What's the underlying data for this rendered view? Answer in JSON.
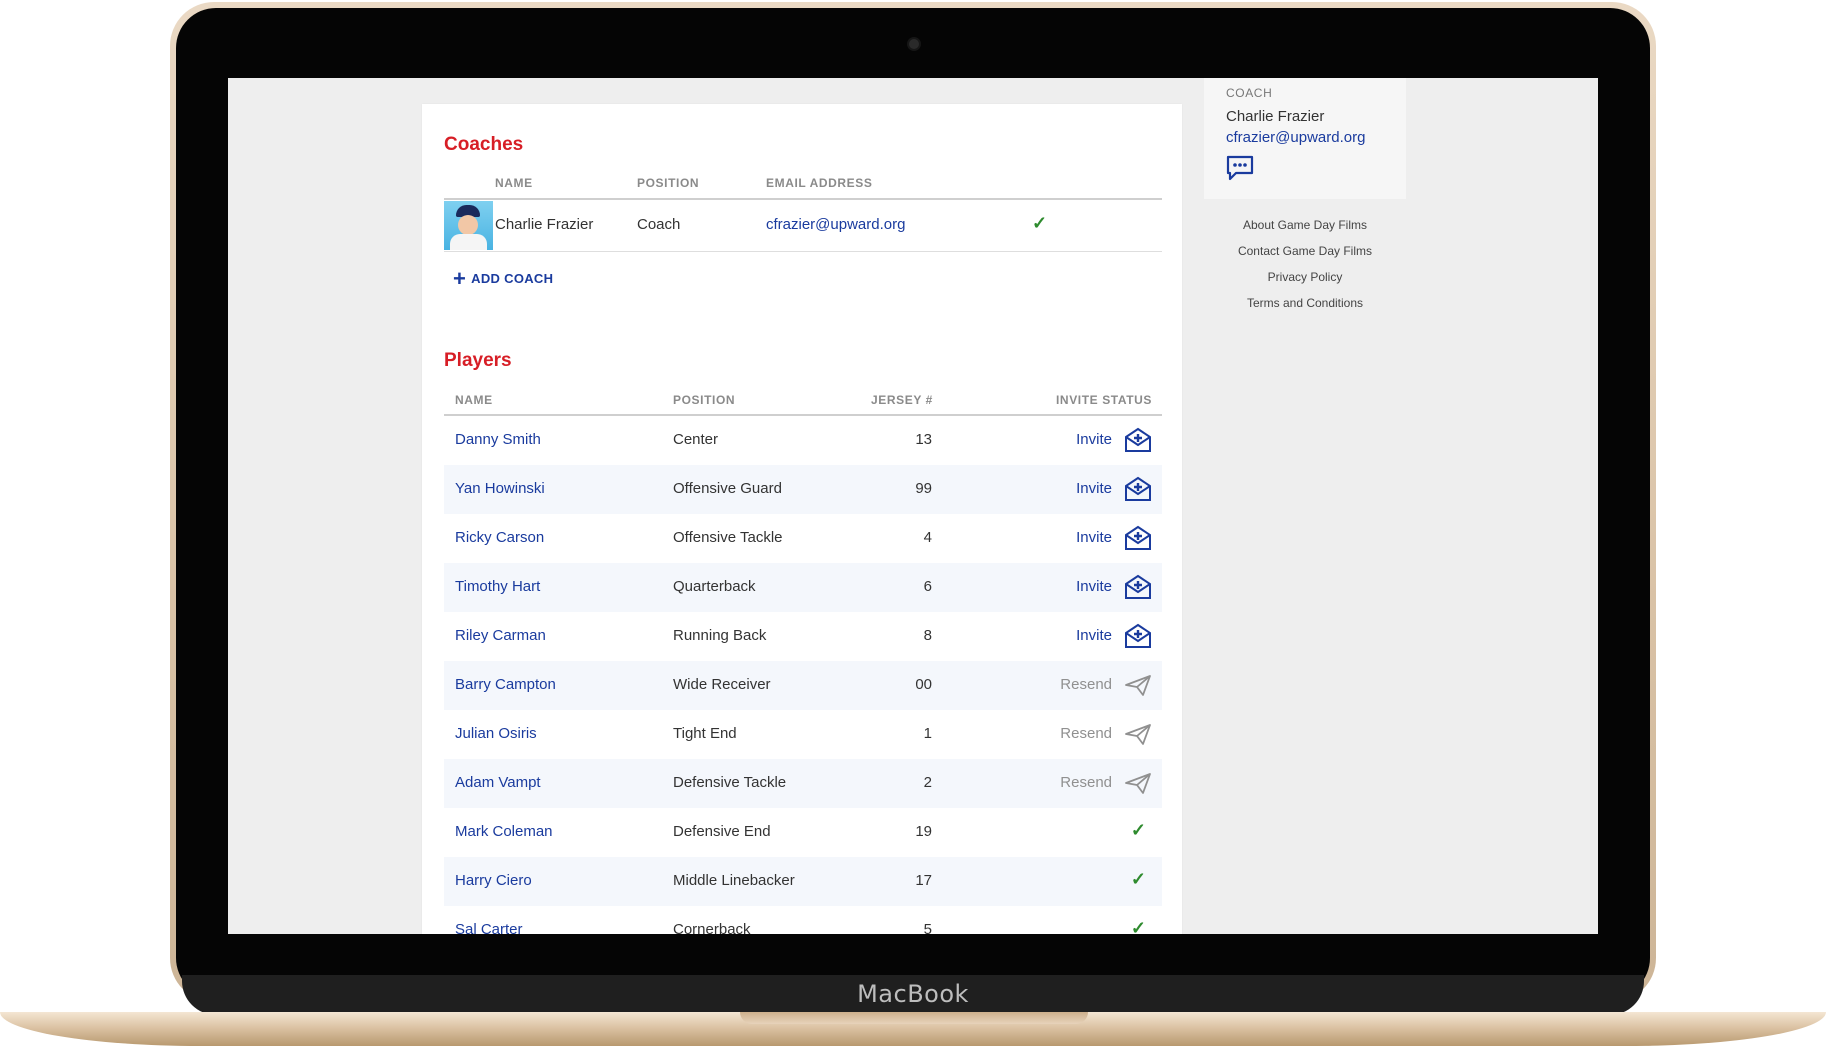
{
  "device": {
    "brand": "MacBook"
  },
  "coaches_section": {
    "title": "Coaches",
    "headers": {
      "name": "NAME",
      "position": "POSITION",
      "email": "EMAIL ADDRESS"
    },
    "rows": [
      {
        "name": "Charlie Frazier",
        "position": "Coach",
        "email": "cfrazier@upward.org",
        "status": "accepted"
      }
    ],
    "add_label": "ADD COACH"
  },
  "players_section": {
    "title": "Players",
    "headers": {
      "name": "NAME",
      "position": "POSITION",
      "jersey": "JERSEY #",
      "invite_status": "INVITE STATUS"
    },
    "rows": [
      {
        "name": "Danny Smith",
        "position": "Center",
        "jersey": "13",
        "status": "Invite"
      },
      {
        "name": "Yan Howinski",
        "position": "Offensive Guard",
        "jersey": "99",
        "status": "Invite"
      },
      {
        "name": "Ricky Carson",
        "position": "Offensive Tackle",
        "jersey": "4",
        "status": "Invite"
      },
      {
        "name": "Timothy Hart",
        "position": "Quarterback",
        "jersey": "6",
        "status": "Invite"
      },
      {
        "name": "Riley Carman",
        "position": "Running Back",
        "jersey": "8",
        "status": "Invite"
      },
      {
        "name": "Barry Campton",
        "position": "Wide Receiver",
        "jersey": "00",
        "status": "Resend"
      },
      {
        "name": "Julian Osiris",
        "position": "Tight End",
        "jersey": "1",
        "status": "Resend"
      },
      {
        "name": "Adam Vampt",
        "position": "Defensive Tackle",
        "jersey": "2",
        "status": "Resend"
      },
      {
        "name": "Mark Coleman",
        "position": "Defensive End",
        "jersey": "19",
        "status": ""
      },
      {
        "name": "Harry Ciero",
        "position": "Middle Linebacker",
        "jersey": "17",
        "status": ""
      },
      {
        "name": "Sal Carter",
        "position": "Cornerback",
        "jersey": "5",
        "status": ""
      }
    ]
  },
  "sidebar": {
    "coach_label": "COACH",
    "coach_name": "Charlie Frazier",
    "coach_email": "cfrazier@upward.org",
    "message_icon": "chat-bubble-icon",
    "links": [
      "About Game Day Films",
      "Contact Game Day Films",
      "Privacy Policy",
      "Terms and Conditions"
    ]
  },
  "colors": {
    "accent_red": "#d71e26",
    "link_blue": "#1a3b9e",
    "check_green": "#2e8b2e",
    "muted_gray": "#909090"
  }
}
